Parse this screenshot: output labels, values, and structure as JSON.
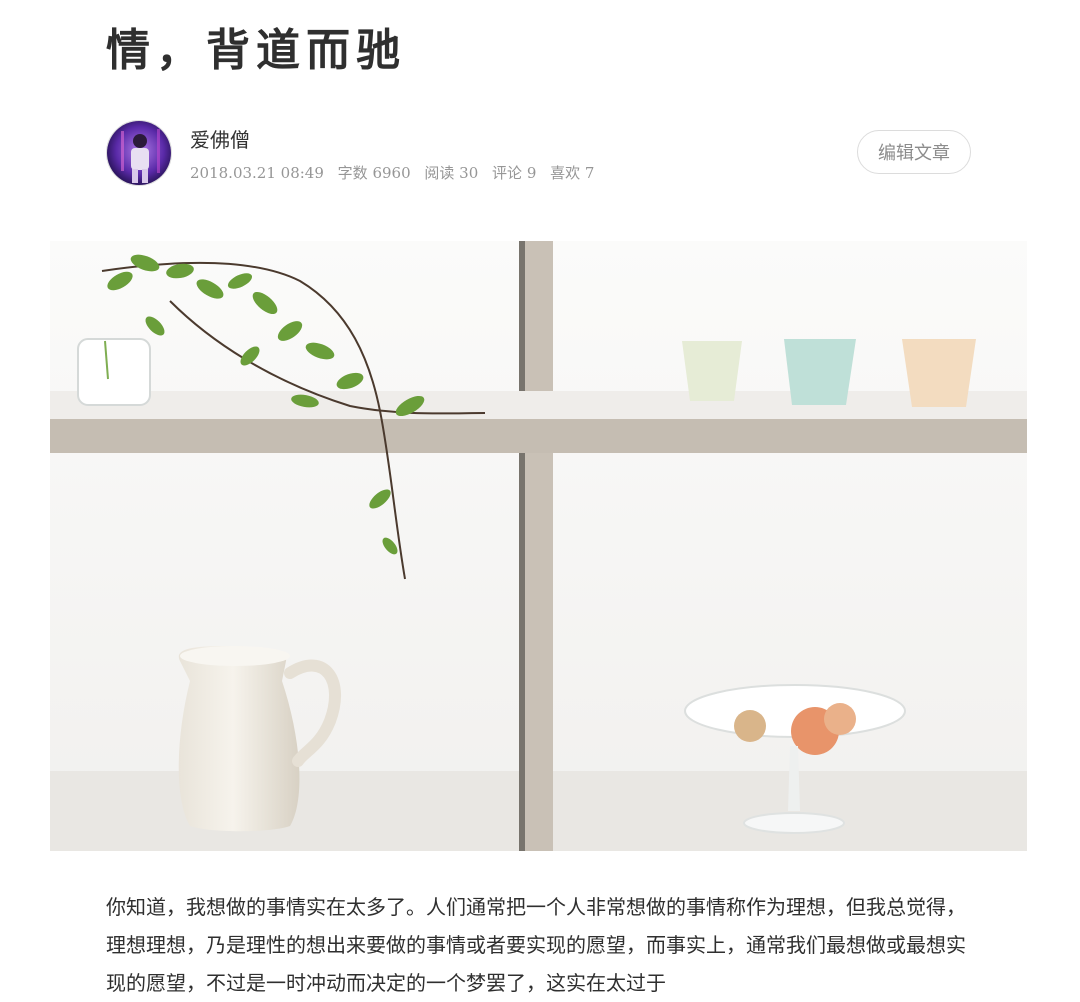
{
  "article": {
    "title": "情，背道而驰",
    "paragraph1": "你知道，我想做的事情实在太多了。人们通常把一个人非常想做的事情称作为理想，但我总觉得，理想理想，乃是理性的想出来要做的事情或者要实现的愿望，而事实上，通常我们最想做或最想实现的愿望，不过是一时冲动而决定的一个梦罢了，这实在太过于"
  },
  "author": {
    "name": "爱佛僧",
    "date": "2018.03.21 08:49",
    "word_count": "字数 6960",
    "reads": "阅读 30",
    "comments": "评论 9",
    "likes": "喜欢 7"
  },
  "actions": {
    "edit_label": "编辑文章"
  },
  "colors": {
    "title": "#2f2f2f",
    "meta": "#969696",
    "shelf": "#c4bcb1",
    "plant": "#6a9e3a"
  }
}
